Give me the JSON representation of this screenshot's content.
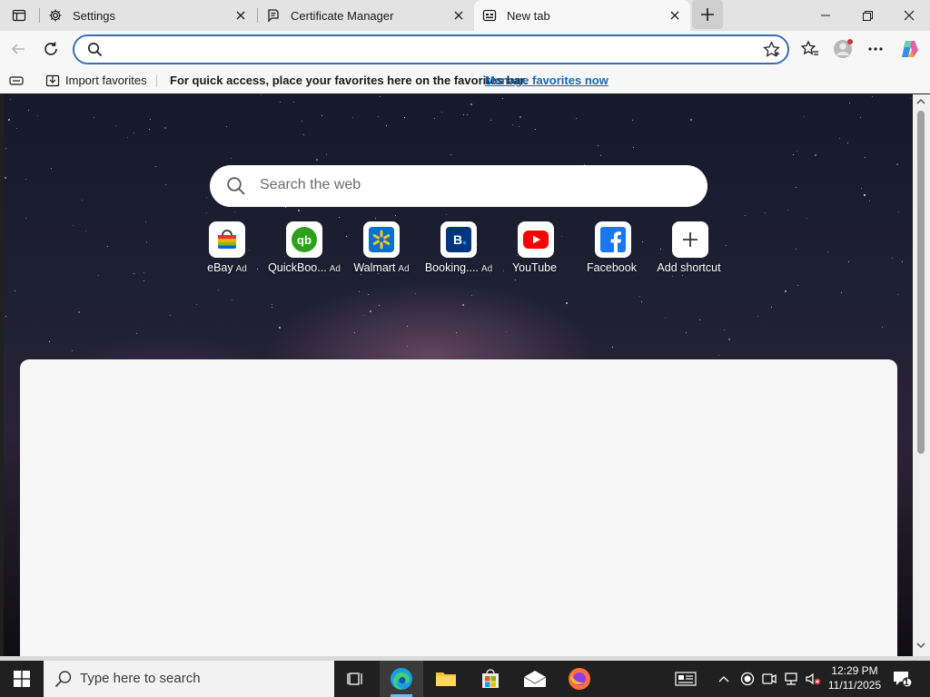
{
  "tabs": [
    {
      "label": "Settings",
      "icon": "gear-icon",
      "active": false
    },
    {
      "label": "Certificate Manager",
      "icon": "certificate-icon",
      "active": false
    },
    {
      "label": "New tab",
      "icon": "newtab-page-icon",
      "active": true
    }
  ],
  "address_bar": {
    "value": "",
    "placeholder": ""
  },
  "favorites_bar": {
    "import_label": "Import favorites",
    "message": "For quick access, place your favorites here on the favorites bar.",
    "manage_link": "Manage favorites now"
  },
  "ntp": {
    "search_placeholder": "Search the web",
    "tiles": [
      {
        "label": "eBay",
        "ad": "Ad",
        "icon": "ebay-icon"
      },
      {
        "label": "QuickBoo...",
        "ad": "Ad",
        "icon": "quickbooks-icon"
      },
      {
        "label": "Walmart",
        "ad": "Ad",
        "icon": "walmart-icon"
      },
      {
        "label": "Booking....",
        "ad": "Ad",
        "icon": "booking-icon"
      },
      {
        "label": "YouTube",
        "ad": "",
        "icon": "youtube-icon"
      },
      {
        "label": "Facebook",
        "ad": "",
        "icon": "facebook-icon"
      },
      {
        "label": "Add shortcut",
        "ad": "",
        "icon": "plus-icon"
      }
    ]
  },
  "taskbar": {
    "search_placeholder": "Type here to search",
    "time": "12:29 PM",
    "date": "11/11/2025",
    "notification_count": "1"
  },
  "colors": {
    "accent": "#3a6fb3",
    "link": "#0f6cbd",
    "taskbar": "#202020"
  }
}
